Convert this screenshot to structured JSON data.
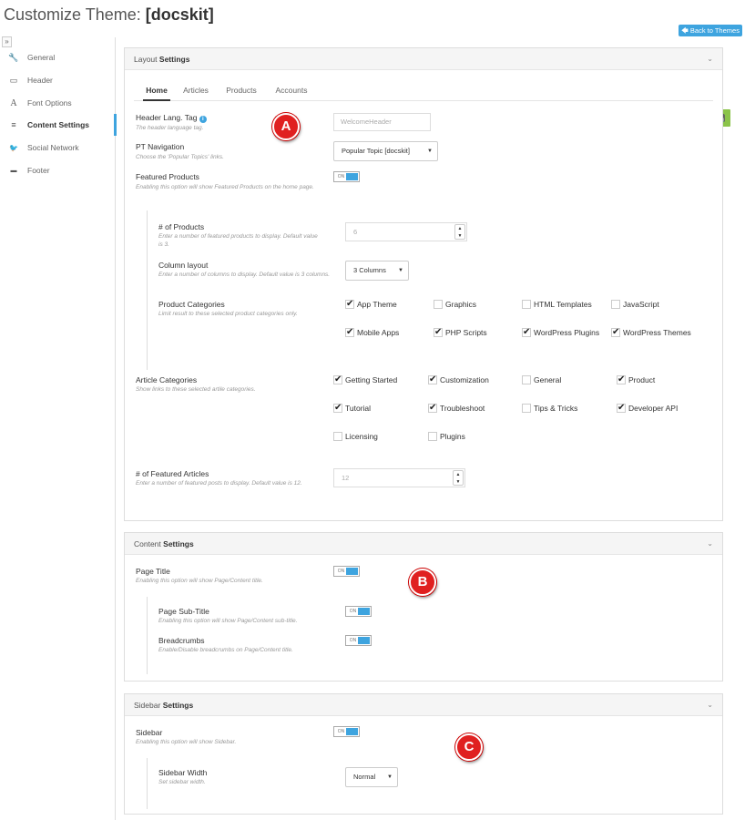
{
  "page": {
    "title_prefix": "Customize Theme:",
    "theme_name": "[docskit]",
    "back_button": "Back to Themes",
    "collapse_glyph": "»"
  },
  "sidebar": {
    "items": [
      {
        "icon": "wrench-icon",
        "glyph": "🔧",
        "label": "General",
        "active": false
      },
      {
        "icon": "window-icon",
        "glyph": "▭",
        "label": "Header",
        "active": false
      },
      {
        "icon": "font-icon",
        "glyph": "A",
        "label": "Font Options",
        "active": false
      },
      {
        "icon": "list-icon",
        "glyph": "≡",
        "label": "Content Settings",
        "active": true
      },
      {
        "icon": "twitter-icon",
        "glyph": "🐦",
        "label": "Social Network",
        "active": false
      },
      {
        "icon": "minus-icon",
        "glyph": "▬",
        "label": "Footer",
        "active": false
      }
    ]
  },
  "layout": {
    "title_light": "Layout",
    "title_bold": "Settings",
    "tabs": [
      "Home",
      "Articles",
      "Products",
      "Accounts"
    ],
    "header_lang": {
      "label": "Header Lang. Tag",
      "hint": "The header language tag.",
      "value": "WelcomeHeader"
    },
    "pt_nav": {
      "label": "PT Navigation",
      "hint": "Choose the 'Popular Topics' links.",
      "value": "Popular Topic [docskit]"
    },
    "featured_products": {
      "label": "Featured Products",
      "hint": "Enabling this option will show Featured Products on the home page.",
      "toggle": "ON"
    },
    "num_products": {
      "label": "# of Products",
      "hint": "Enter a number of featured products to display. Default value is 3.",
      "value": "6"
    },
    "column_layout": {
      "label": "Column layout",
      "hint": "Enter a number of columns to display. Default value is 3 columns.",
      "value": "3 Columns"
    },
    "product_categories": {
      "label": "Product Categories",
      "hint": "Limit result to these selected product categories only.",
      "options": [
        {
          "label": "App Theme",
          "checked": true
        },
        {
          "label": "Graphics",
          "checked": false
        },
        {
          "label": "HTML Templates",
          "checked": false
        },
        {
          "label": "JavaScript",
          "checked": false
        },
        {
          "label": "Mobile Apps",
          "checked": true
        },
        {
          "label": "PHP Scripts",
          "checked": true
        },
        {
          "label": "WordPress Plugins",
          "checked": true
        },
        {
          "label": "WordPress Themes",
          "checked": true
        }
      ]
    },
    "article_categories": {
      "label": "Article Categories",
      "hint": "Show links to these selected artile categories.",
      "options": [
        {
          "label": "Getting Started",
          "checked": true
        },
        {
          "label": "Customization",
          "checked": true
        },
        {
          "label": "General",
          "checked": false
        },
        {
          "label": "Product",
          "checked": true
        },
        {
          "label": "Tutorial",
          "checked": true
        },
        {
          "label": "Troubleshoot",
          "checked": true
        },
        {
          "label": "Tips & Tricks",
          "checked": false
        },
        {
          "label": "Developer API",
          "checked": true
        },
        {
          "label": "Licensing",
          "checked": false
        },
        {
          "label": "Plugins",
          "checked": false
        }
      ]
    },
    "featured_articles": {
      "label": "# of Featured Articles",
      "hint": "Enter a number of featured posts to display. Default value is 12.",
      "value": "12"
    }
  },
  "content": {
    "title_light": "Content",
    "title_bold": "Settings",
    "page_title": {
      "label": "Page Title",
      "hint": "Enabling this option will show Page/Content title.",
      "toggle": "ON"
    },
    "page_subtitle": {
      "label": "Page Sub-Title",
      "hint": "Enabling this option will show Page/Content sub-title.",
      "toggle": "ON"
    },
    "breadcrumbs": {
      "label": "Breadcrumbs",
      "hint": "Enable/Disable breadcrumbs on Page/Content title.",
      "toggle": "ON"
    }
  },
  "sidebar_settings": {
    "title_light": "Sidebar",
    "title_bold": "Settings",
    "sidebar": {
      "label": "Sidebar",
      "hint": "Enabling this option will show Sidebar.",
      "toggle": "ON"
    },
    "width": {
      "label": "Sidebar Width",
      "hint": "Set sidebar width.",
      "value": "Normal"
    }
  },
  "markers": {
    "a": "A",
    "b": "B",
    "c": "C"
  },
  "glyphs": {
    "chevron": "⌄",
    "caret": "▼",
    "spin_up": "▲",
    "spin_down": "▼",
    "check": "✔",
    "save": "💾",
    "info": "i",
    "back_arrow": "🡄"
  },
  "colors": {
    "accent": "#3ea4df",
    "save": "#8bc34a",
    "marker": "#e02020"
  }
}
